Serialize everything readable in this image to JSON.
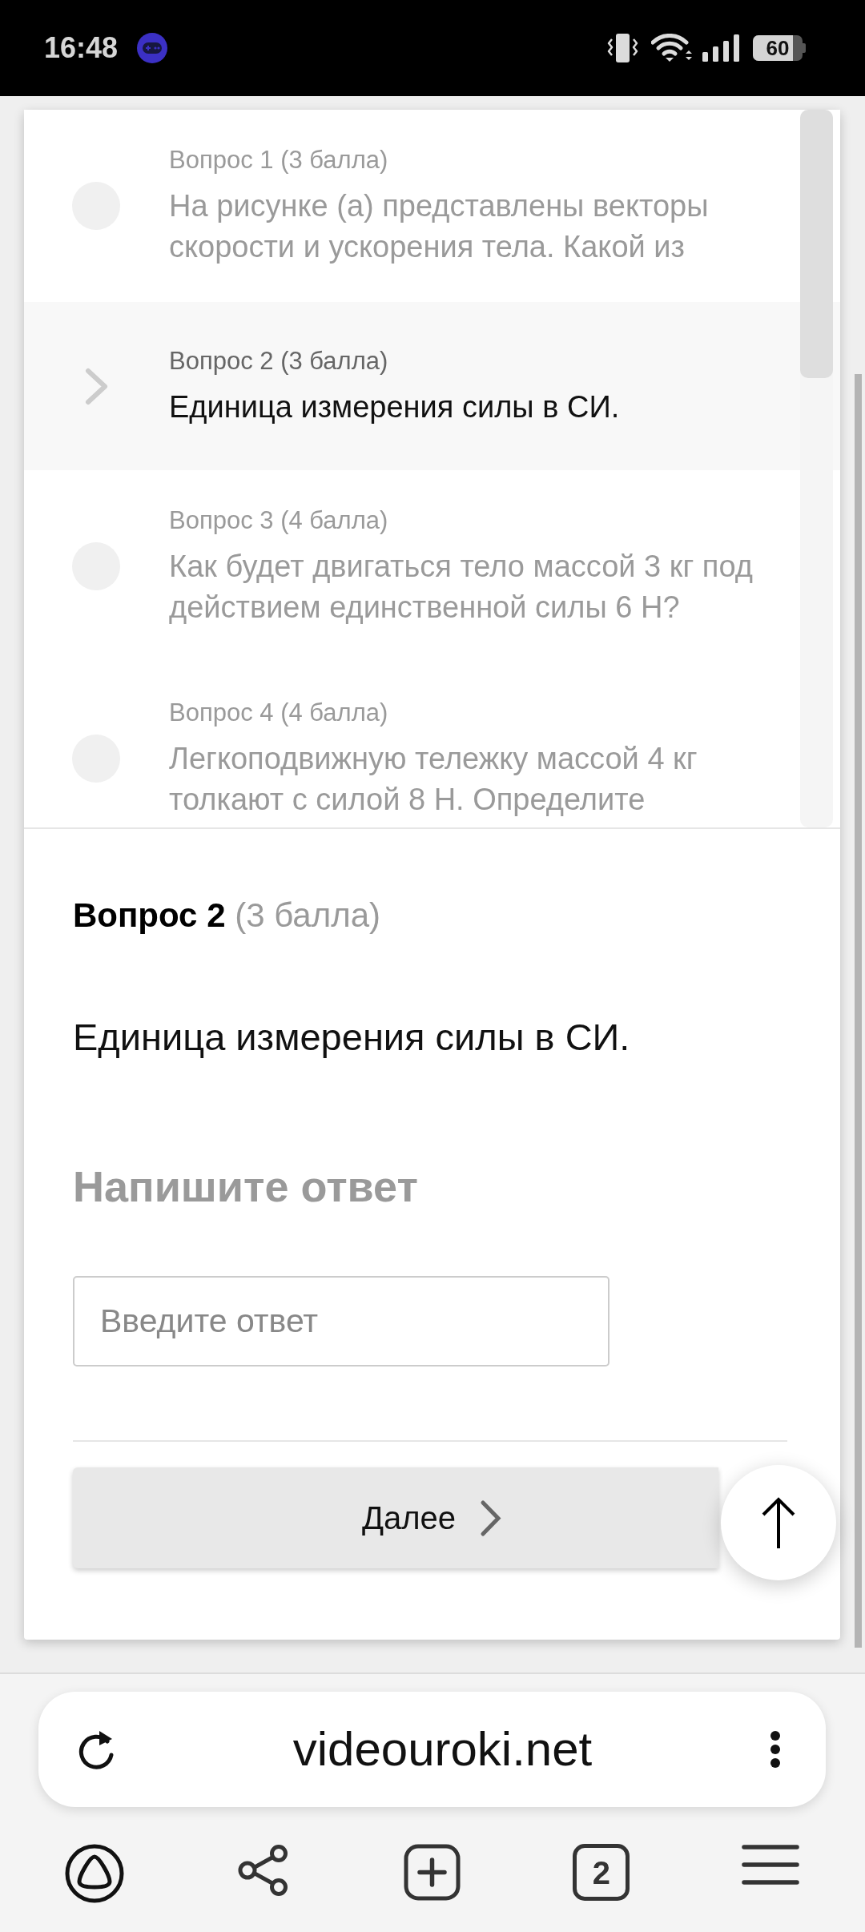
{
  "status_bar": {
    "time": "16:48",
    "battery": "60"
  },
  "question_list": {
    "items": [
      {
        "label": "Вопрос 1 (3 балла)",
        "text": "На рисунке (а) представлены векторы скорости и ускорения тела. Какой из",
        "selected": false
      },
      {
        "label": "Вопрос 2 (3 балла)",
        "text": "Единица измерения силы в СИ.",
        "selected": true
      },
      {
        "label": "Вопрос 3 (4 балла)",
        "text": "Как будет двигаться тело массой 3 кг под действием единственной силы 6 Н?",
        "selected": false
      },
      {
        "label": "Вопрос 4 (4 балла)",
        "text": "Легкоподвижную тележку массой 4 кг толкают с силой 8 Н. Определите",
        "selected": false
      }
    ]
  },
  "question": {
    "number": "Вопрос 2",
    "points": "(3 балла)",
    "text": "Единица измерения силы в СИ.",
    "answer_prompt": "Напишите ответ",
    "answer_field": {
      "placeholder": "Введите ответ"
    },
    "next_button": "Далее"
  },
  "browser": {
    "url": "videouroki.net",
    "tab_count": "2"
  }
}
